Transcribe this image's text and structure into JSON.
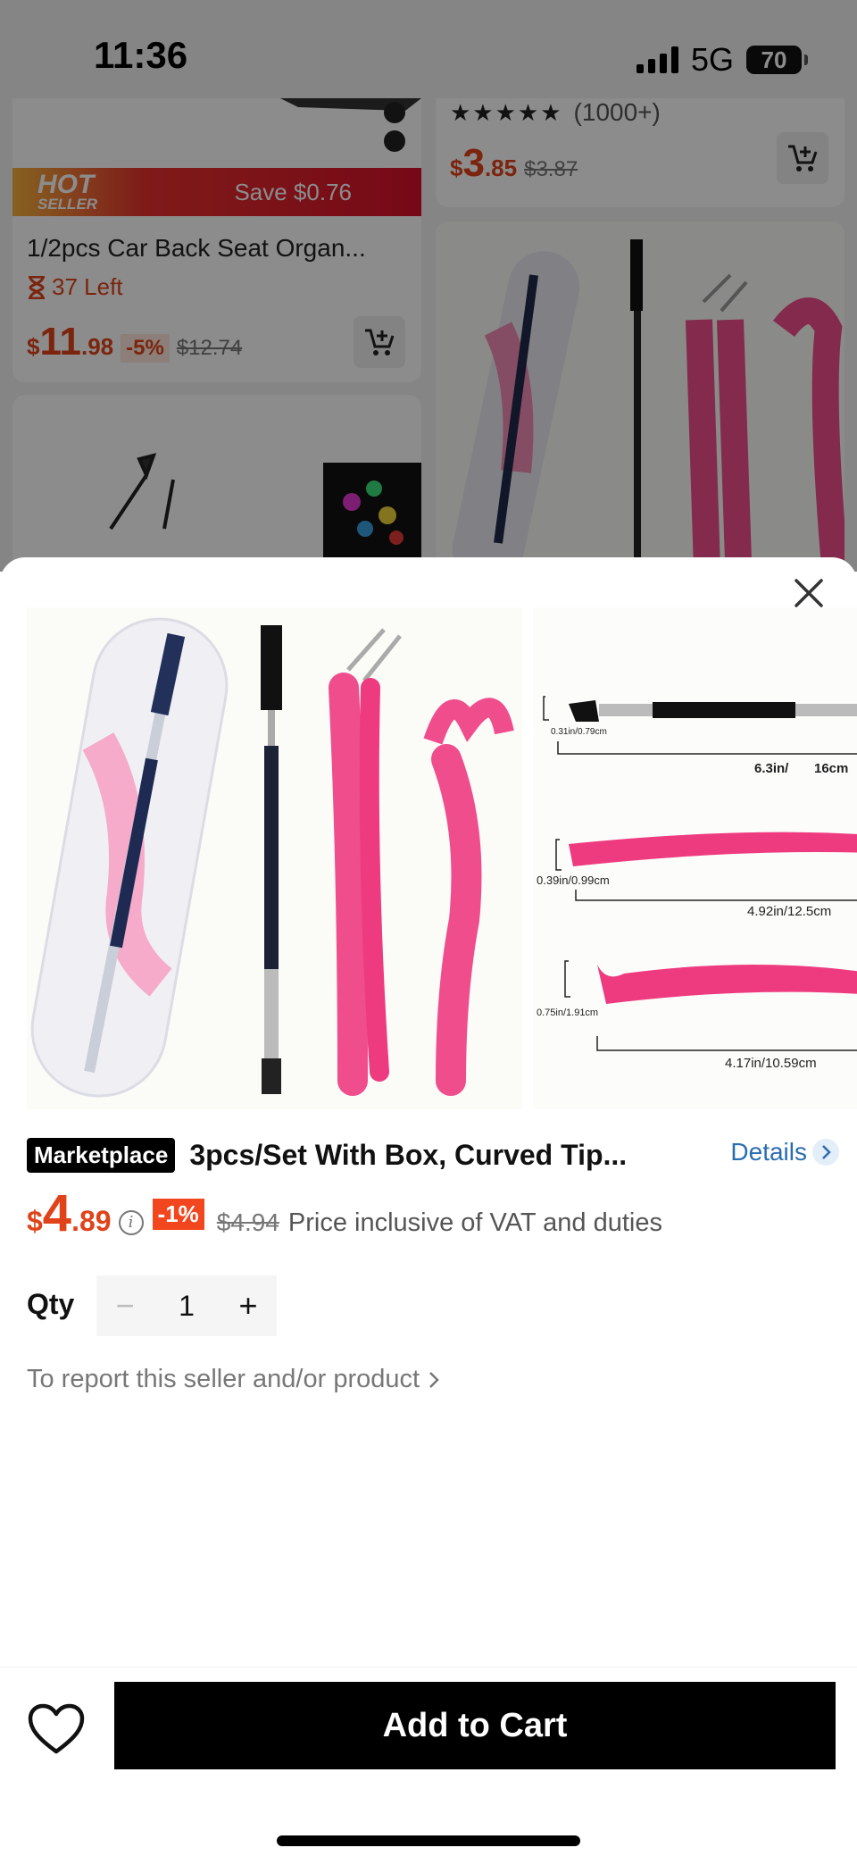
{
  "status": {
    "time": "11:36",
    "network": "5G",
    "battery": "70"
  },
  "background": {
    "left_card": {
      "badge_top": "HOT",
      "badge_bottom": "SELLER",
      "save_text": "Save $0.76",
      "title": "1/2pcs Car Back Seat Organ...",
      "stock": "37 Left",
      "price_currency": "$",
      "price_int": "11",
      "price_dec": ".98",
      "discount": "-5%",
      "original_price": "$12.74"
    },
    "right_card": {
      "stars": "★★★★★",
      "rating_count": "(1000+)",
      "price_currency": "$",
      "price_int": "3",
      "price_dec": ".85",
      "original_price": "$3.87"
    }
  },
  "sheet": {
    "gallery": {
      "measurements": [
        "0.31in/0.79cm",
        "6.3in/",
        "16cm",
        "0.39in/0.99cm",
        "4.92in/12.5cm",
        "0.75in/1.91cm",
        "4.17in/10.59cm"
      ]
    },
    "badge": "Marketplace",
    "title": "3pcs/Set With Box, Curved Tip...",
    "details_label": "Details",
    "price": {
      "currency": "$",
      "int": "4",
      "dec": ".89",
      "discount": "-1%",
      "original": "$4.94",
      "vat_note": "Price inclusive of VAT and duties"
    },
    "qty": {
      "label": "Qty",
      "value": "1",
      "minus": "−",
      "plus": "+"
    },
    "report_text": "To report this seller and/or product"
  },
  "bottom_bar": {
    "add_to_cart_label": "Add to Cart"
  },
  "colors": {
    "accent_price": "#e0431a",
    "discount_badge": "#f2461e",
    "details_link": "#2a6db0",
    "primary_button": "#000000"
  }
}
